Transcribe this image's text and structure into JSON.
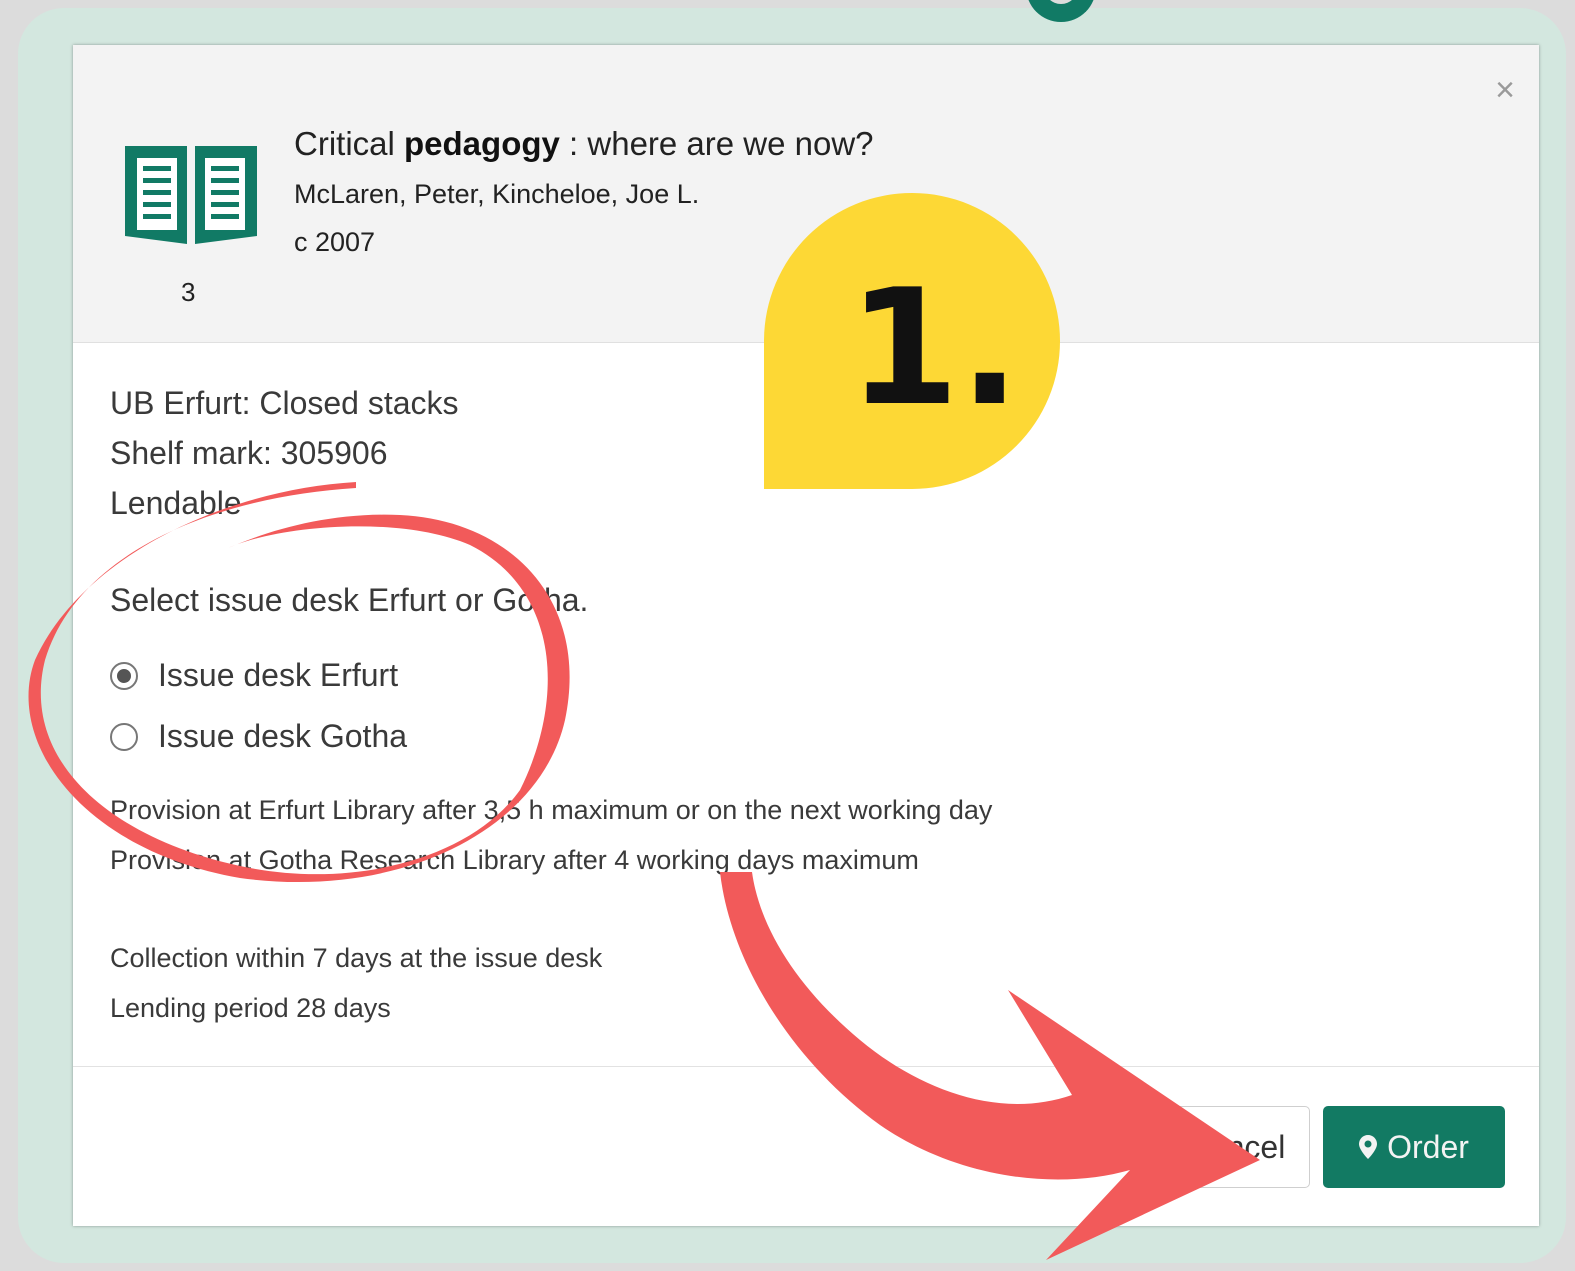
{
  "dialog": {
    "close_label": "×",
    "record": {
      "title_prefix": "Critical ",
      "title_highlight": "pedagogy",
      "title_suffix": " : where are we now?",
      "authors": "McLaren, Peter, Kincheloe, Joe L.",
      "year": "c 2007",
      "count": "3",
      "icon": "open-book-icon"
    },
    "location": "UB Erfurt: Closed stacks",
    "shelf_mark": "Shelf mark: 305906",
    "status": "Lendable",
    "select_prompt": "Select issue desk Erfurt or Gotha.",
    "options": [
      {
        "label": "Issue desk Erfurt",
        "checked": true
      },
      {
        "label": "Issue desk Gotha",
        "checked": false
      }
    ],
    "provision_erfurt": "Provision at Erfurt Library after 3,5 h maximum or on the next working day",
    "provision_gotha": "Provision at Gotha Research Library after 4 working days maximum",
    "collection_note": "Collection within 7 days at the issue desk",
    "lending_period": "Lending period 28 days",
    "cancel_label": "Cancel",
    "order_label": "Order",
    "order_icon": "map-marker-icon"
  },
  "annotation": {
    "step_label": "1.",
    "badge_color": "#fdd835",
    "marker_color": "#f25a5a"
  },
  "colors": {
    "frame": "#d3e7df",
    "accent": "#127a63"
  }
}
